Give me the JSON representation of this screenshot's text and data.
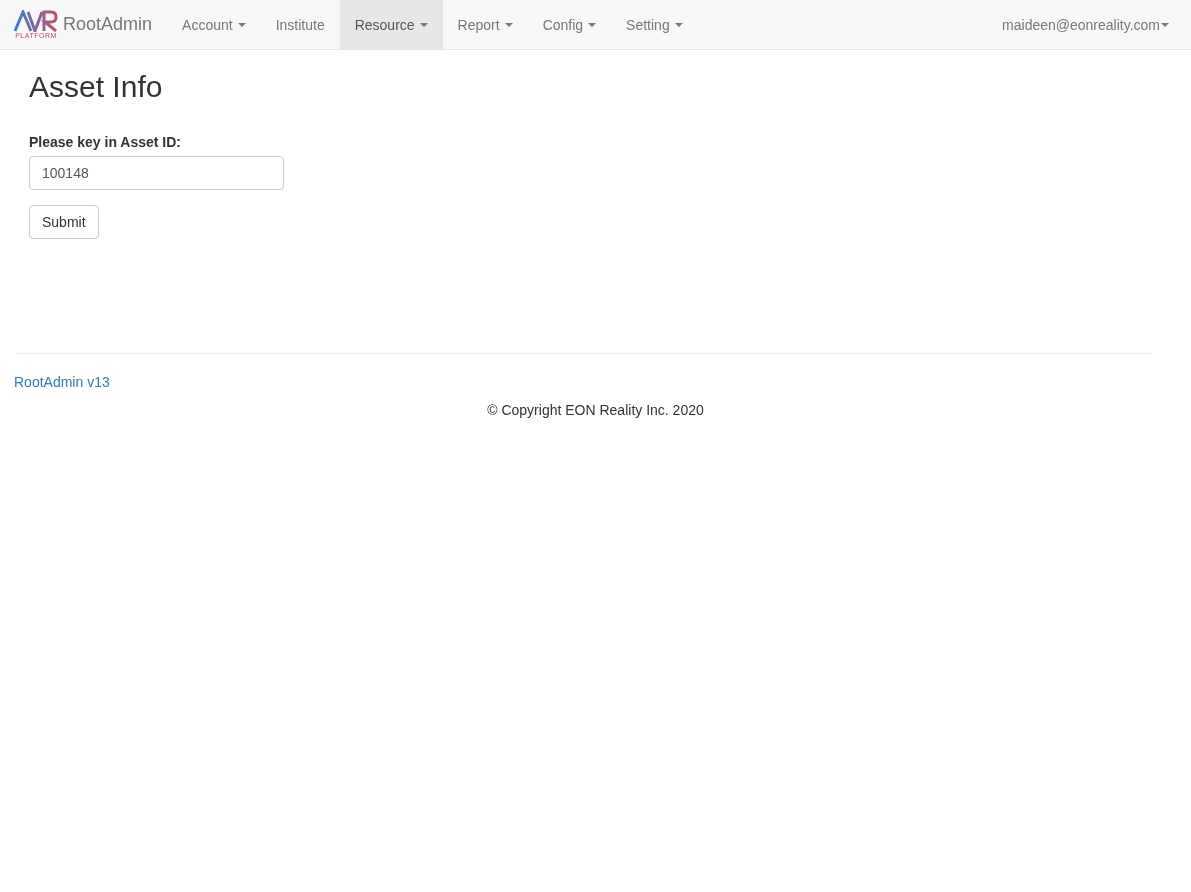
{
  "navbar": {
    "brand": {
      "logo_text": "PLATFORM",
      "name": "RootAdmin"
    },
    "items": [
      {
        "label": "Account",
        "dropdown": true,
        "selected": false
      },
      {
        "label": "Institute",
        "dropdown": false,
        "selected": false
      },
      {
        "label": "Resource",
        "dropdown": true,
        "selected": true
      },
      {
        "label": "Report",
        "dropdown": true,
        "selected": false
      },
      {
        "label": "Config",
        "dropdown": true,
        "selected": false
      },
      {
        "label": "Setting",
        "dropdown": true,
        "selected": false
      }
    ],
    "user": {
      "label": "maideen@eonreality.com",
      "dropdown": true
    }
  },
  "page": {
    "title": "Asset Info",
    "field": {
      "label": "Please key in Asset ID:",
      "value": "100148"
    },
    "submit": "Submit"
  },
  "footer": {
    "version_link": "RootAdmin v13",
    "copyright": "© Copyright EON Reality Inc. 2020"
  }
}
